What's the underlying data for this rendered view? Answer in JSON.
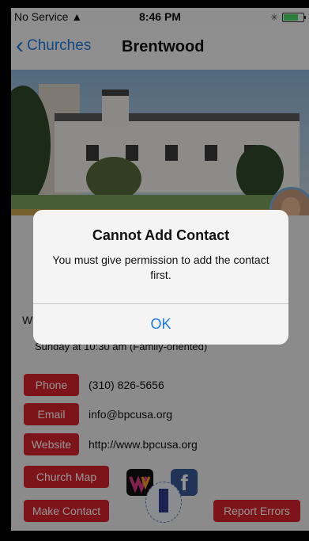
{
  "status_bar": {
    "carrier": "No Service",
    "time": "8:46 PM"
  },
  "nav": {
    "back_label": "Churches",
    "title": "Brentwood"
  },
  "content": {
    "partial_heading": "W",
    "service_time": "Sunday at 10:30 am (Family-oriented)",
    "phone_label": "Phone",
    "phone_value": "(310) 826-5656",
    "email_label": "Email",
    "email_value": "info@bpcusa.org",
    "website_label": "Website",
    "website_value": "http://www.bpcusa.org",
    "map_label": "Church Map",
    "make_contact_label": "Make Contact",
    "report_errors_label": "Report Errors"
  },
  "icons": {
    "wu": "wu-logo-icon",
    "facebook": "facebook-icon",
    "seal": "church-seal-icon"
  },
  "alert": {
    "title": "Cannot Add Contact",
    "message": "You must give permission to add the contact first.",
    "ok_label": "OK"
  },
  "colors": {
    "accent": "#1f7ae0",
    "button_red": "#d8242b"
  }
}
